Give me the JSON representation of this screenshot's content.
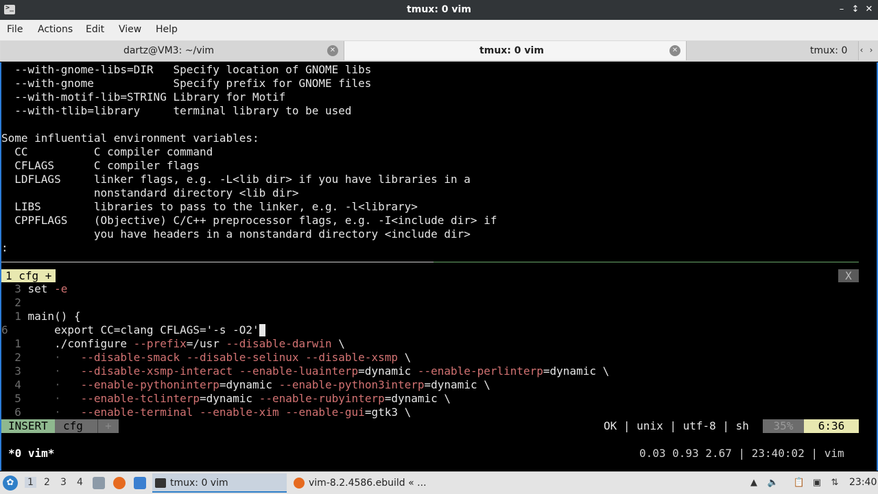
{
  "window": {
    "title": "tmux: 0 vim",
    "icon": "terminal-icon"
  },
  "menu": [
    "File",
    "Actions",
    "Edit",
    "View",
    "Help"
  ],
  "tabs": [
    {
      "label": "dartz@VM3: ~/vim"
    },
    {
      "label": "tmux: 0 vim"
    },
    {
      "label": "tmux: 0"
    }
  ],
  "pager_lines": [
    "  --with-gnome-libs=DIR   Specify location of GNOME libs",
    "  --with-gnome            Specify prefix for GNOME files",
    "  --with-motif-lib=STRING Library for Motif",
    "  --with-tlib=library     terminal library to be used",
    "",
    "Some influential environment variables:",
    "  CC          C compiler command",
    "  CFLAGS      C compiler flags",
    "  LDFLAGS     linker flags, e.g. -L<lib dir> if you have libraries in a",
    "              nonstandard directory <lib dir>",
    "  LIBS        libraries to pass to the linker, e.g. -l<library>",
    "  CPPFLAGS    (Objective) C/C++ preprocessor flags, e.g. -I<include dir> if",
    "              you have headers in a nonstandard directory <include dir>",
    ":"
  ],
  "vim": {
    "tab_label": "1 cfg +",
    "close_label": "X",
    "mode": "INSERT",
    "file": "cfg",
    "modified": "+",
    "info": "OK | unix | utf-8 | sh",
    "percent": "35%",
    "position": "6:36"
  },
  "tmux": {
    "left": "*0 vim*",
    "right": "0.03 0.93 2.67 | 23:40:02 | vim"
  },
  "taskbar": {
    "workspaces": [
      "1",
      "2",
      "3",
      "4"
    ],
    "tasks": [
      "tmux: 0 vim",
      "vim-8.2.4586.ebuild « ..."
    ],
    "clock": "23:40"
  },
  "colors": {
    "accent": "#2b7bd6",
    "status_mode": "#8fb88f",
    "status_pos": "#e8e8b0",
    "option": "#d27272"
  }
}
